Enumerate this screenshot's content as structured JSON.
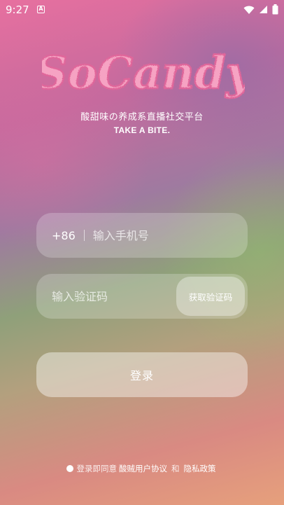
{
  "status_bar": {
    "time": "9:27",
    "notification_badge": "A",
    "icons": [
      "wifi-icon",
      "cellular-signal-icon",
      "battery-icon"
    ]
  },
  "logo": {
    "text": "SoCandy",
    "color": "#f6a3c3"
  },
  "tagline": {
    "cn": "酸甜味の养成系直播社交平台",
    "en": "TAKE A BITE."
  },
  "phone_field": {
    "country_code": "+86",
    "placeholder": "输入手机号",
    "value": ""
  },
  "code_field": {
    "placeholder": "输入验证码",
    "value": "",
    "get_code_label": "获取验证码"
  },
  "login_button": {
    "label": "登录"
  },
  "agreement": {
    "checked": false,
    "prefix": "登录即同意",
    "user_agreement": "酸贼用户协议",
    "and": "和",
    "privacy_policy": "隐私政策"
  }
}
